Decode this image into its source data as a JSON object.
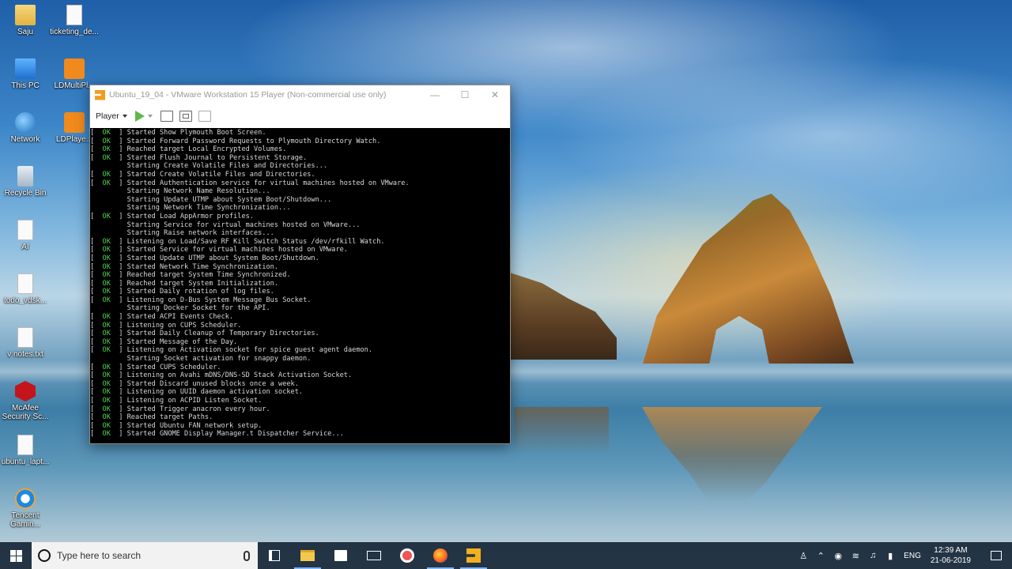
{
  "desktop": {
    "icons": [
      {
        "label": "Saju"
      },
      {
        "label": "ticketing_de..."
      },
      {
        "label": "This PC"
      },
      {
        "label": "LDMultiPl..."
      },
      {
        "label": "Network"
      },
      {
        "label": "LDPlaye..."
      },
      {
        "label": "Recycle Bin"
      },
      {
        "label": "AI"
      },
      {
        "label": "todo_vdsk..."
      },
      {
        "label": "v notes.txt"
      },
      {
        "label": "McAfee Security Sc..."
      },
      {
        "label": "ubuntu_lapt..."
      },
      {
        "label": "Tencent Gamin..."
      }
    ]
  },
  "vmware": {
    "title": "Ubuntu_19_04 - VMware Workstation 15 Player (Non-commercial use only)",
    "player_menu": "Player",
    "minimize": "—",
    "maximize": "☐",
    "close": "✕"
  },
  "console": {
    "lines": [
      {
        "status": "[  OK  ]",
        "text": " Started Show Plymouth Boot Screen."
      },
      {
        "status": "[  OK  ]",
        "text": " Started Forward Password Requests to Plymouth Directory Watch."
      },
      {
        "status": "[  OK  ]",
        "text": " Reached target Local Encrypted Volumes."
      },
      {
        "status": "[  OK  ]",
        "text": " Started Flush Journal to Persistent Storage."
      },
      {
        "status": "",
        "text": "         Starting Create Volatile Files and Directories..."
      },
      {
        "status": "[  OK  ]",
        "text": " Started Create Volatile Files and Directories."
      },
      {
        "status": "[  OK  ]",
        "text": " Started Authentication service for virtual machines hosted on VMware."
      },
      {
        "status": "",
        "text": "         Starting Network Name Resolution..."
      },
      {
        "status": "",
        "text": "         Starting Update UTMP about System Boot/Shutdown..."
      },
      {
        "status": "",
        "text": "         Starting Network Time Synchronization..."
      },
      {
        "status": "[  OK  ]",
        "text": " Started Load AppArmor profiles."
      },
      {
        "status": "",
        "text": "         Starting Service for virtual machines hosted on VMware..."
      },
      {
        "status": "",
        "text": "         Starting Raise network interfaces..."
      },
      {
        "status": "[  OK  ]",
        "text": " Listening on Load/Save RF Kill Switch Status /dev/rfkill Watch."
      },
      {
        "status": "[  OK  ]",
        "text": " Started Service for virtual machines hosted on VMware."
      },
      {
        "status": "[  OK  ]",
        "text": " Started Update UTMP about System Boot/Shutdown."
      },
      {
        "status": "[  OK  ]",
        "text": " Started Network Time Synchronization."
      },
      {
        "status": "[  OK  ]",
        "text": " Reached target System Time Synchronized."
      },
      {
        "status": "[  OK  ]",
        "text": " Reached target System Initialization."
      },
      {
        "status": "[  OK  ]",
        "text": " Started Daily rotation of log files."
      },
      {
        "status": "[  OK  ]",
        "text": " Listening on D-Bus System Message Bus Socket."
      },
      {
        "status": "",
        "text": "         Starting Docker Socket for the API."
      },
      {
        "status": "[  OK  ]",
        "text": " Started ACPI Events Check."
      },
      {
        "status": "[  OK  ]",
        "text": " Listening on CUPS Scheduler."
      },
      {
        "status": "[  OK  ]",
        "text": " Started Daily Cleanup of Temporary Directories."
      },
      {
        "status": "[  OK  ]",
        "text": " Started Message of the Day."
      },
      {
        "status": "[  OK  ]",
        "text": " Listening on Activation socket for spice guest agent daemon."
      },
      {
        "status": "",
        "text": "         Starting Socket activation for snappy daemon."
      },
      {
        "status": "[  OK  ]",
        "text": " Started CUPS Scheduler."
      },
      {
        "status": "[  OK  ]",
        "text": " Listening on Avahi mDNS/DNS-SD Stack Activation Socket."
      },
      {
        "status": "[  OK  ]",
        "text": " Started Discard unused blocks once a week."
      },
      {
        "status": "[  OK  ]",
        "text": " Listening on UUID daemon activation socket."
      },
      {
        "status": "[  OK  ]",
        "text": " Listening on ACPID Listen Socket."
      },
      {
        "status": "[  OK  ]",
        "text": " Started Trigger anacron every hour."
      },
      {
        "status": "[  OK  ]",
        "text": " Reached target Paths."
      },
      {
        "status": "[  OK  ]",
        "text": " Started Ubuntu FAN network setup."
      },
      {
        "status": "[  OK  ]",
        "text": " Started GNOME Display Manager.t Dispatcher Service..."
      }
    ]
  },
  "taskbar": {
    "search_placeholder": "Type here to search",
    "language": "ENG",
    "time": "12:39 AM",
    "date": "21-06-2019"
  }
}
